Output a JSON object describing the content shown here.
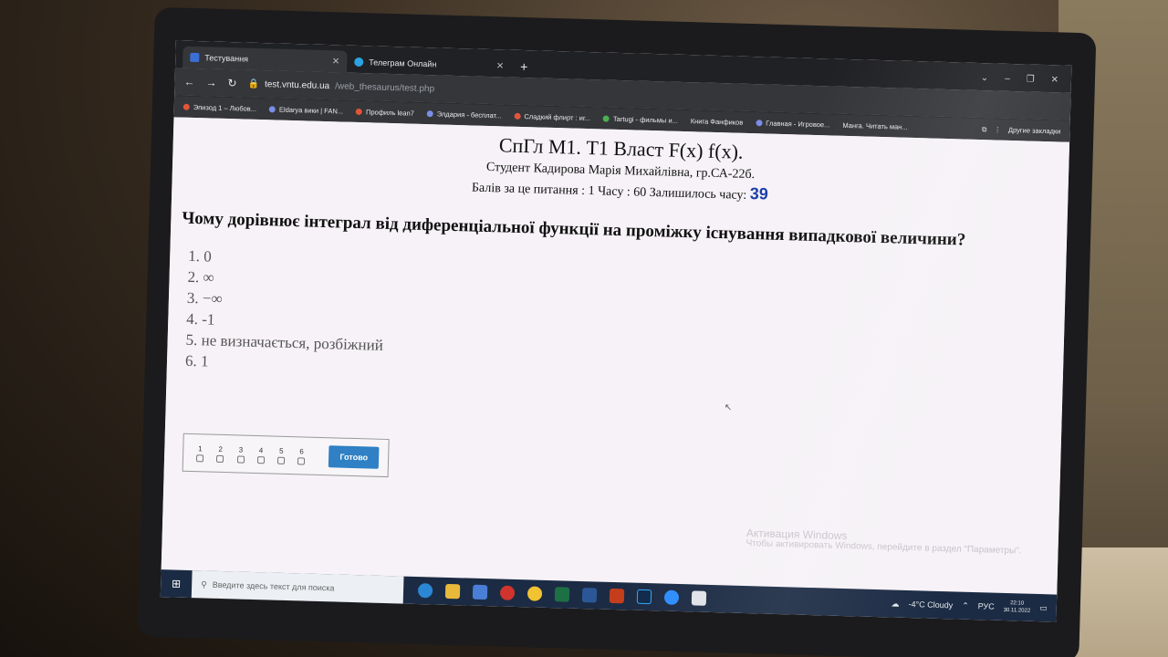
{
  "browser": {
    "tabs": [
      {
        "label": "Тестування",
        "active": true
      },
      {
        "label": "Телеграм Онлайн",
        "active": false
      }
    ],
    "new_tab": "+",
    "address": {
      "domain": "test.vntu.edu.ua",
      "path": "/web_thesaurus/test.php"
    },
    "bookmarks": [
      "Эпизод 1 – Любов...",
      "Eldarya вики | FAN...",
      "Профиль lean7",
      "Элдария - бесплат...",
      "Сладкий флирт : иг...",
      "Tartugi - фильмы и...",
      "Книга Фанфиков",
      "Главная - Игровое...",
      "Манга. Читать ман..."
    ],
    "other_bookmarks": "Другие закладки"
  },
  "test": {
    "title": "СпГл М1. Т1 Власт F(x) f(x).",
    "student": "Студент Кадирова Марія Михайлівна, гр.СА-22б.",
    "meta": "Балів за це питання : 1 Часу : 60 Залишилось часу:",
    "time_left": "39",
    "question": "Чому дорівнює інтеграл від диференціальної функції на проміжку існування випадкової величини?",
    "answers": [
      "1. 0",
      "2. ∞",
      "3. −∞",
      "4. -1",
      "5. не визначається, розбіжний",
      "6. 1"
    ],
    "option_numbers": [
      "1",
      "2",
      "3",
      "4",
      "5",
      "6"
    ],
    "submit_label": "Готово"
  },
  "windows_watermark": {
    "title": "Активация Windows",
    "text": "Чтобы активировать Windows, перейдите в раздел \"Параметры\"."
  },
  "taskbar": {
    "search_placeholder": "Введите здесь текст для поиска",
    "weather": "-4°C Cloudy",
    "lang": "РУС",
    "time": "22:10",
    "date": "30.11.2022"
  }
}
